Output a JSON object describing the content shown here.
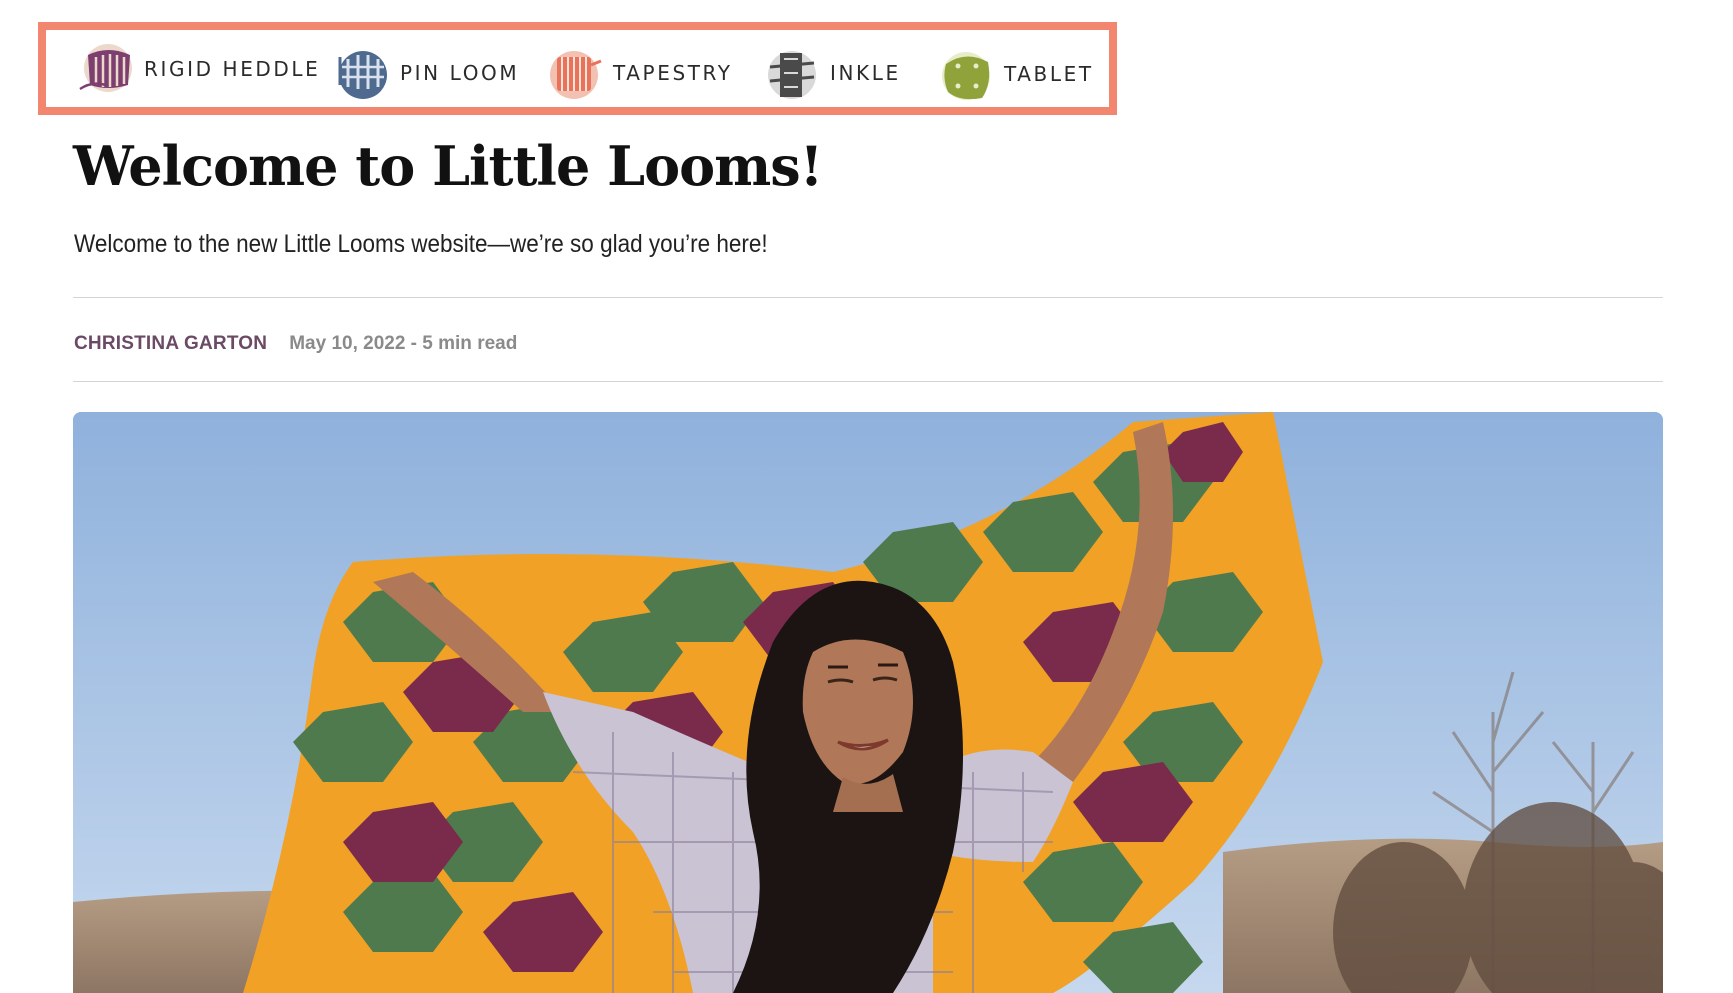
{
  "nav": {
    "items": [
      {
        "label": "RIGID HEDDLE",
        "icon": "rigid-heddle-icon",
        "color": "#7d3f6f"
      },
      {
        "label": "PIN LOOM",
        "icon": "pin-loom-icon",
        "color": "#4e6b8f"
      },
      {
        "label": "TAPESTRY",
        "icon": "tapestry-icon",
        "color": "#e8735a"
      },
      {
        "label": "INKLE",
        "icon": "inkle-icon",
        "color": "#4a4a4a"
      },
      {
        "label": "TABLET",
        "icon": "tablet-icon",
        "color": "#8fa33a"
      }
    ],
    "highlight_color": "#f2866f"
  },
  "article": {
    "title": "Welcome to Little Looms!",
    "dek": "Welcome to the new Little Looms website—we’re so glad you’re here!",
    "author": "CHRISTINA GARTON",
    "meta": "May 10, 2022 - 5 min read",
    "author_color": "#6b4a65",
    "meta_color": "#8a8a8a"
  },
  "hero": {
    "subject": "hero-photo",
    "colors": {
      "sky": "#a9c4e4",
      "hill": "#a8917b",
      "gold": "#f0a126",
      "green": "#4f7a4e",
      "plum": "#7a2a4a",
      "shirt": "#c9c3d4",
      "hair": "#1b1412",
      "skin": "#b07858"
    }
  }
}
